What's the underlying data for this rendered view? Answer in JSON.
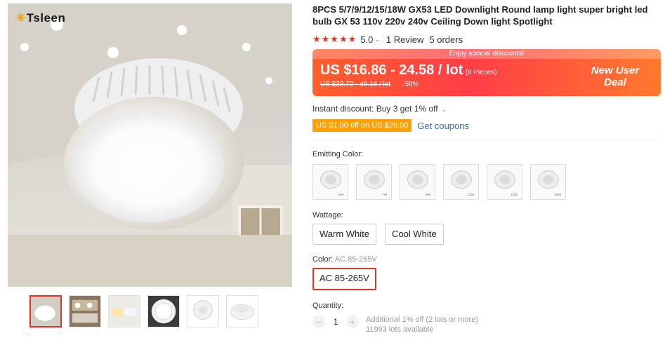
{
  "brand": {
    "name": "Tsleen"
  },
  "gallery": {
    "main_image_icon": "led-downlight-photo",
    "thumbnails": [
      "thumb-room-lamp",
      "thumb-lamp-sizes",
      "thumb-warm-cool",
      "thumb-led-chips",
      "thumb-lamp-front",
      "thumb-lamp-side"
    ]
  },
  "product": {
    "title": "8PCS 5/7/9/12/15/18W GX53 LED Downlight Round lamp light super bright led bulb GX 53 110v 220v 240v Ceiling Down light Spotlight",
    "stars": "★★★★★",
    "rating": "5.0",
    "reviews": "1 Review",
    "orders": "5 orders"
  },
  "price": {
    "banner": "Enjoy special discounts!",
    "current": "US $16.86 - 24.58 / lot",
    "pieces": "(8 Pieces)",
    "original": "US $33.72 - 49.16 / lot",
    "discount": "-50%",
    "new_user_line1": "New User",
    "new_user_line2": "Deal",
    "accent_color": "#ff3d47"
  },
  "discount": {
    "instant": "Instant discount: Buy 3 get 1% off",
    "coupon": "US $1.00 off on US $20.00",
    "get_coupons": "Get coupons"
  },
  "emitting_color": {
    "label": "Emitting Color:",
    "swatch_captions": [
      "5W",
      "7W",
      "9W",
      "12W",
      "15W",
      "18W"
    ]
  },
  "wattage": {
    "label": "Wattage:",
    "options": [
      "Warm White",
      "Cool White"
    ]
  },
  "color": {
    "label": "Color:",
    "selected_value": "AC 85-265V",
    "options": [
      "AC 85-265V"
    ]
  },
  "quantity": {
    "label": "Quantity:",
    "minus": "−",
    "value": "1",
    "plus": "+",
    "note1": "Additional 1% off (2 lots or more)",
    "note2": "11993 lots available"
  }
}
